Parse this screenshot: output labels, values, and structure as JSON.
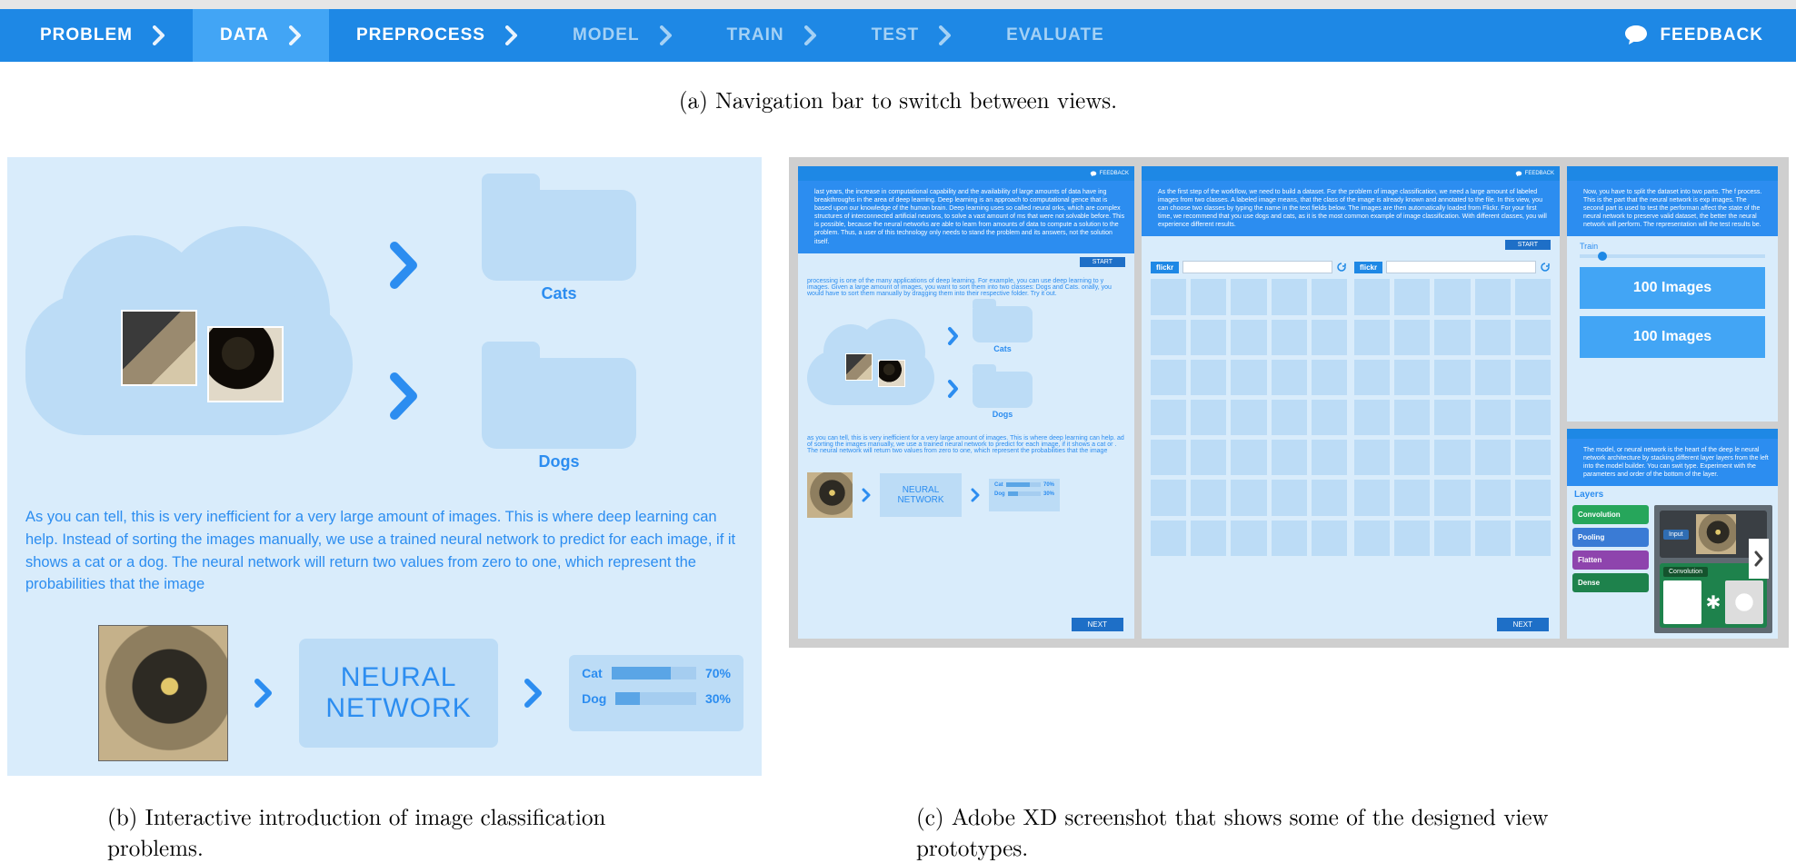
{
  "nav": {
    "items": [
      {
        "label": "PROBLEM",
        "state": "done"
      },
      {
        "label": "DATA",
        "state": "active"
      },
      {
        "label": "PREPROCESS",
        "state": "done"
      },
      {
        "label": "MODEL",
        "state": "dim"
      },
      {
        "label": "TRAIN",
        "state": "dim"
      },
      {
        "label": "TEST",
        "state": "dim"
      },
      {
        "label": "EVALUATE",
        "state": "dim"
      }
    ],
    "feedback_label": "FEEDBACK"
  },
  "captions": {
    "a": "(a) Navigation bar to switch between views.",
    "b": "(b) Interactive introduction of image classification problems.",
    "c": "(c) Adobe XD screenshot that shows some of the designed view prototypes."
  },
  "panel_b": {
    "folder1": "Cats",
    "folder2": "Dogs",
    "paragraph": "As you can tell, this is very inefficient for a very large amount of images. This is where deep learning can help. Instead of sorting the images manually, we use a trained neural network to predict for each image, if it shows a cat or a dog. The neural network will return two values from zero to one, which represent the probabilities that the image",
    "nn_label": "NEURAL NETWORK",
    "probs": [
      {
        "name": "Cat",
        "pct": "70%",
        "fill": 70
      },
      {
        "name": "Dog",
        "pct": "30%",
        "fill": 30
      }
    ]
  },
  "panel_c": {
    "mini_feedback": "FEEDBACK",
    "proto1": {
      "desc": "last years, the increase in computational capability and the availability of large amounts of data have ing breakthroughs in the area of deep learning. Deep learning is an approach to computational gence that is based upon our knowledge of the human brain. Deep learning uses so called neural orks, which are complex structures of interconnected artificial neurons, to solve a vast amount of ms that were not solvable before. This is possible, because the neural networks are able to learn from amounts of data to compute a solution to the problem. Thus, a user of this technology only needs to stand the problem and its answers, not the solution itself.",
      "start": "START",
      "body_text": "processing is one of the many applications of deep learning. For example, you can use deep learning to y images. Given a large amount of images, you want to sort them into two classes: Dogs and Cats. onally, you would have to sort them manually by dragging them into their respective folder. Try it out.",
      "para": "as you can tell, this is very inefficient for a very large amount of images. This is where deep learning can help. ad of sorting the images manually, we use a trained neural network to predict for each image, if it shows a cat or . The neural network will return two values from zero to one, which represent the probabilities that the image",
      "folder1": "Cats",
      "folder2": "Dogs",
      "nn": "NEURAL NETWORK",
      "p_cat": "Cat",
      "p_cat_v": "70%",
      "p_dog": "Dog",
      "p_dog_v": "30%",
      "next": "NEXT"
    },
    "proto2": {
      "desc": "As the first step of the workflow, we need to build a dataset. For the problem of image classification, we need a large amount of labeled images from two classes. A labeled image means, that the class of the image is already known and annotated to the file. In this view, you can choose two classes by typing the name in the text fields below. The images are then automatically loaded from Flickr. For your first time, we recommend that you use dogs and cats, as it is the most common example of image classification. With different classes, you will experience different results.",
      "start": "START",
      "flickr": "flickr",
      "next": "NEXT"
    },
    "proto3_top": {
      "desc": "Now, you have to split the dataset into two parts. The f process. This is the part that the neural network is exp images. The second part is used to test the performan affect the state of the neural network to preserve valid dataset, the better the neural network will perform. The representation will the test results be.",
      "slider_label": "Train",
      "btn": "100 Images"
    },
    "proto3_bot": {
      "desc": "The model, or neural network is the heart of the deep le neural network architecture by stacking different layer layers from the left into the model builder. You can swit type. Experiment with the parameters and order of the bottom of the layer.",
      "layers_title": "Layers",
      "layers": [
        "Convolution",
        "Pooling",
        "Flatten",
        "Dense"
      ],
      "input_tag": "Input",
      "conv_tag": "Convolution"
    }
  }
}
